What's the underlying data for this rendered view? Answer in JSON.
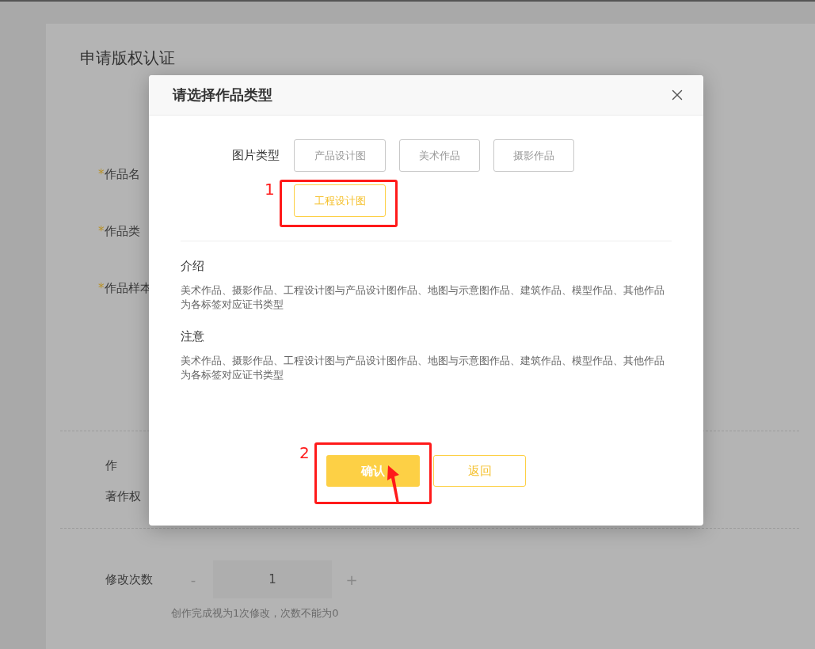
{
  "page": {
    "title": "申请版权认证",
    "fields": [
      {
        "marker": "*",
        "label": "作品名"
      },
      {
        "marker": "*",
        "label": "作品类"
      },
      {
        "marker": "*",
        "label": "作品样本"
      }
    ],
    "author_rows": [
      {
        "label": "作"
      },
      {
        "label": "著作权"
      }
    ],
    "revisions": {
      "label": "修改次数",
      "decrement": "-",
      "value": "1",
      "increment": "+",
      "hint": "创作完成视为1次修改，次数不能为0"
    }
  },
  "dialog": {
    "title": "请选择作品类型",
    "category": {
      "label": "图片类型",
      "options": [
        {
          "label": "产品设计图",
          "selected": false
        },
        {
          "label": "美术作品",
          "selected": false
        },
        {
          "label": "摄影作品",
          "selected": false
        },
        {
          "label": "工程设计图",
          "selected": true,
          "annotation": "1"
        }
      ]
    },
    "sections": [
      {
        "heading": "介绍",
        "text": "美术作品、摄影作品、工程设计图与产品设计图作品、地图与示意图作品、建筑作品、模型作品、其他作品为各标签对应证书类型"
      },
      {
        "heading": "注意",
        "text": "美术作品、摄影作品、工程设计图与产品设计图作品、地图与示意图作品、建筑作品、模型作品、其他作品为各标签对应证书类型"
      }
    ],
    "buttons": [
      {
        "label": "确认",
        "kind": "primary",
        "annotation": "2"
      },
      {
        "label": "返回",
        "kind": "secondary"
      }
    ]
  }
}
